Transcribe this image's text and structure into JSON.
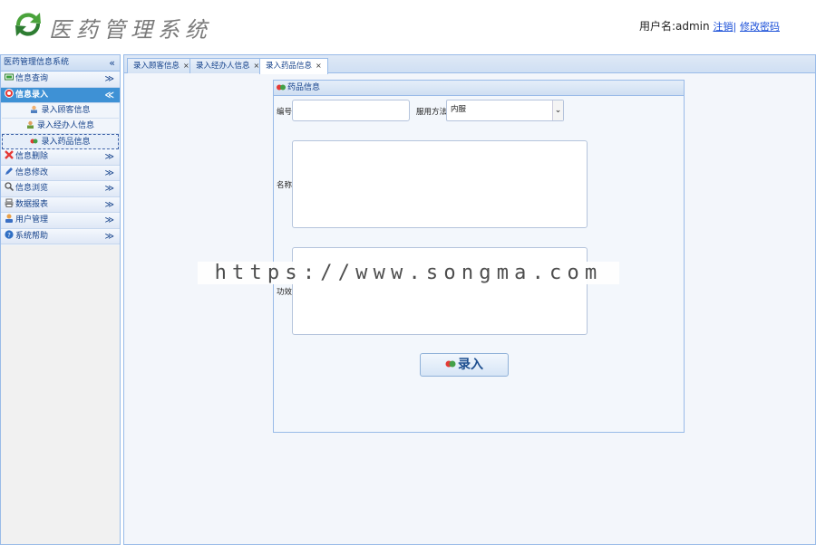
{
  "header": {
    "app_title": "医药管理系统",
    "user_label": "用户名:admin",
    "logout_link": "注销",
    "separator": "|",
    "change_password_link": "修改密码"
  },
  "sidebar": {
    "title": "医药管理信息系统",
    "collapse_glyph": "«",
    "groups": [
      {
        "label": "信息查询",
        "icon": "monitor-icon",
        "state": "collapsed",
        "chevron": "≫"
      },
      {
        "label": "信息录入",
        "icon": "record-icon",
        "state": "expanded",
        "chevron": "≪",
        "items": [
          {
            "label": "录入顾客信息",
            "icon": "customer-icon"
          },
          {
            "label": "录入经办人信息",
            "icon": "agent-icon"
          },
          {
            "label": "录入药品信息",
            "icon": "pill-icon"
          }
        ]
      },
      {
        "label": "信息删除",
        "icon": "delete-icon",
        "state": "collapsed",
        "chevron": "≫"
      },
      {
        "label": "信息修改",
        "icon": "edit-icon",
        "state": "collapsed",
        "chevron": "≫"
      },
      {
        "label": "信息浏览",
        "icon": "search-icon",
        "state": "collapsed",
        "chevron": "≫"
      },
      {
        "label": "数据报表",
        "icon": "printer-icon",
        "state": "collapsed",
        "chevron": "≫"
      },
      {
        "label": "用户管理",
        "icon": "user-icon",
        "state": "collapsed",
        "chevron": "≫"
      },
      {
        "label": "系统帮助",
        "icon": "help-icon",
        "state": "collapsed",
        "chevron": "≫"
      }
    ]
  },
  "tabs": [
    {
      "label": "录入顾客信息",
      "close": "×",
      "active": false
    },
    {
      "label": "录入经办人信息",
      "close": "×",
      "active": false
    },
    {
      "label": "录入药品信息",
      "close": "×",
      "active": true
    }
  ],
  "form": {
    "panel_title": "药品信息",
    "code_label": "编号:",
    "code_value": "",
    "usage_label": "服用方法:",
    "usage_value": "内服",
    "name_label": "名称:",
    "name_value": "",
    "effect_label": "功效:",
    "effect_value": "",
    "submit_label": "录入"
  },
  "watermark": "https://www.songma.com",
  "colors": {
    "border": "#99bbe8",
    "active_menu": "#3e91d5",
    "link": "#1a4fd8"
  }
}
